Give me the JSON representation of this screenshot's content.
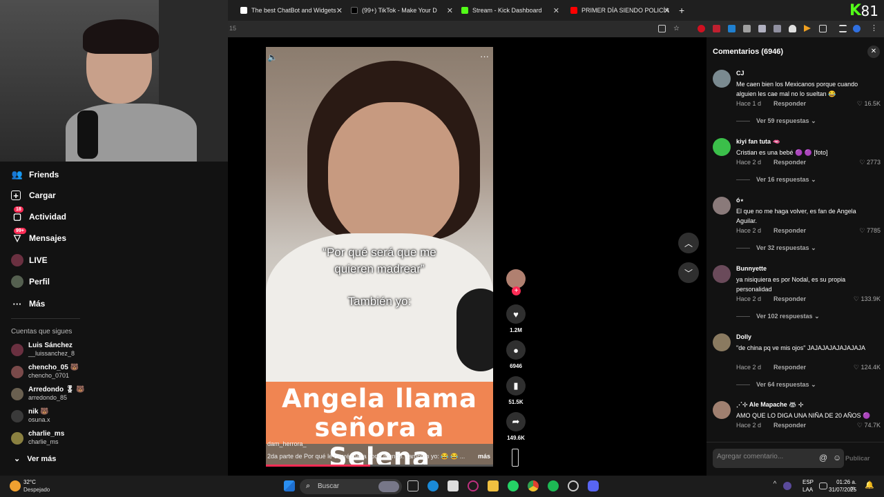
{
  "browser": {
    "tabs": [
      {
        "title": "The best ChatBot and Widgets",
        "color": "#ffffff"
      },
      {
        "title": "(99+) TikTok - Make Your D",
        "color": "#000000"
      },
      {
        "title": "Stream - Kick Dashboard",
        "color": "#53fc18"
      },
      {
        "title": "PRIMER DÍA SIENDO POLICÍA |",
        "color": "#ff0000"
      }
    ],
    "url_fragment": "15",
    "kick_viewers": "81"
  },
  "sidebar": {
    "nav": [
      {
        "label": "Friends",
        "icon": "friends-icon"
      },
      {
        "label": "Cargar",
        "icon": "upload-icon"
      },
      {
        "label": "Actividad",
        "icon": "activity-icon",
        "badge": "18"
      },
      {
        "label": "Mensajes",
        "icon": "messages-icon",
        "badge": "99+"
      },
      {
        "label": "LIVE",
        "icon": "live-icon"
      },
      {
        "label": "Perfil",
        "icon": "profile-icon"
      },
      {
        "label": "Más",
        "icon": "more-icon"
      }
    ],
    "following_title": "Cuentas que sigues",
    "following": [
      {
        "name": "Luis Sánchez",
        "user": "__luissanchez_8"
      },
      {
        "name": "chencho_05 🐻",
        "user": "chencho_0701"
      },
      {
        "name": "Arredondo 🎖 🐻",
        "user": "arredondo_85"
      },
      {
        "name": "nik 🐻",
        "user": "osuna.x"
      },
      {
        "name": "charlie_ms",
        "user": "charlie_ms"
      }
    ],
    "see_more": "Ver más"
  },
  "video": {
    "caption1": "“Por qué será que me",
    "caption2": "quieren madrear”",
    "caption3": "También yo:",
    "banner1": "Angela llama",
    "banner2": "señora a Selena",
    "author": "dam_herrora_",
    "description": "2da parte de Por qué le caeré mal a Todo mundo. También yo: 😂 😂 ...",
    "more": "más",
    "progress": 0.46
  },
  "actions": {
    "likes": "1.2M",
    "comments": "6946",
    "saves": "51.5K",
    "shares": "149.6K"
  },
  "comments_panel": {
    "title": "Comentarios (6946)",
    "reply_label": "Responder",
    "items": [
      {
        "author": "CJ",
        "text": "Me caen bien los Mexicanos porque cuando alguien les cae mal no lo sueltan 😂",
        "time": "Hace 1 d",
        "likes": "16.5K",
        "more": "Ver 59 respuestas",
        "avatar": "#7a8a90"
      },
      {
        "author": "kiyi fan tuta 🫦",
        "text": "Cristian es una bebé 🟣 🟣 [foto]",
        "time": "Hace 2 d",
        "likes": "2773",
        "more": "Ver 16 respuestas",
        "avatar": "#3bbf4a"
      },
      {
        "author": "ó⋆",
        "text": "El que no me haga volver, es fan de Angela Aguilar.",
        "time": "Hace 2 d",
        "likes": "7785",
        "more": "Ver 32 respuestas",
        "avatar": "#8a7a7a"
      },
      {
        "author": "Bunnyette",
        "text": "ya nisiquiera es por Nodal, es su propia personalidad",
        "time": "Hace 2 d",
        "likes": "133.9K",
        "more": "Ver 102 respuestas",
        "avatar": "#6a4a5a"
      },
      {
        "author": "Dolly",
        "text": "\"de china pq ve mis ojos\" JAJAJAJAJAJAJAJA",
        "time": "Hace 2 d",
        "likes": "124.4K",
        "more": "Ver 64 respuestas",
        "avatar": "#8a7a60"
      },
      {
        "author": "⋰⊹ Ale Mapache 🦝 ⊹",
        "text": "AMO QUE LO DIGA UNA NIÑA DE 20 AÑOS 🟣",
        "time": "Hace 2 d",
        "likes": "74.7K",
        "more": "",
        "avatar": "#a08070"
      }
    ],
    "input_placeholder": "Agregar comentario...",
    "post_label": "Publicar"
  },
  "taskbar": {
    "temp": "32°C",
    "weather": "Despejado",
    "search": "Buscar",
    "lang1": "ESP",
    "lang2": "LAA",
    "time": "01:26 a. m.",
    "date": "31/07/2025"
  }
}
